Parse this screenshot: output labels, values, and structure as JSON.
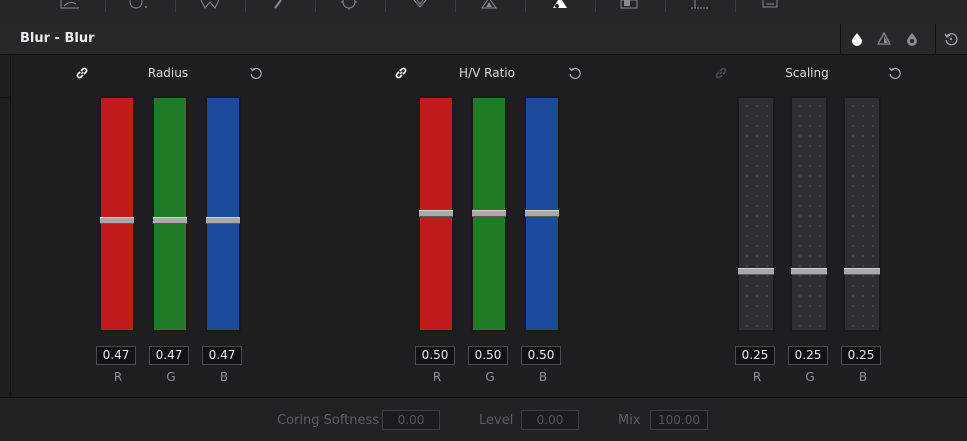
{
  "toolbar": {
    "tools": [
      {
        "icon": "curves-icon"
      },
      {
        "icon": "warper-icon"
      },
      {
        "icon": "qualifier-icon"
      },
      {
        "icon": "window-icon"
      },
      {
        "icon": "tracker-icon"
      },
      {
        "icon": "magic-mask-icon"
      },
      {
        "icon": "blur-icon",
        "active": true
      },
      {
        "icon": "key-icon"
      },
      {
        "icon": "sizing-icon"
      },
      {
        "icon": "3d-icon"
      }
    ]
  },
  "header": {
    "title": "Blur - Blur",
    "mode_icons": [
      "blur-mode-icon",
      "sharpen-mode-icon",
      "mist-mode-icon"
    ],
    "reset_icon": "reset-all-icon"
  },
  "groups": [
    {
      "title": "Radius",
      "linked": true,
      "channels": [
        {
          "label": "R",
          "value": "0.47"
        },
        {
          "label": "G",
          "value": "0.47"
        },
        {
          "label": "B",
          "value": "0.47"
        }
      ],
      "level": 0.47
    },
    {
      "title": "H/V Ratio",
      "linked": true,
      "channels": [
        {
          "label": "R",
          "value": "0.50"
        },
        {
          "label": "G",
          "value": "0.50"
        },
        {
          "label": "B",
          "value": "0.50"
        }
      ],
      "level": 0.5
    },
    {
      "title": "Scaling",
      "linked": false,
      "channels": [
        {
          "label": "R",
          "value": "0.25"
        },
        {
          "label": "G",
          "value": "0.25"
        },
        {
          "label": "B",
          "value": "0.25"
        }
      ],
      "level": 0.25
    }
  ],
  "channel_colors": {
    "R": "#c21b1b",
    "G": "#1f7c24",
    "B": "#1a4a99"
  },
  "footer": {
    "coring_softness_label": "Coring Softness",
    "coring_softness_value": "0.00",
    "level_label": "Level",
    "level_value": "0.00",
    "mix_label": "Mix",
    "mix_value": "100.00"
  }
}
